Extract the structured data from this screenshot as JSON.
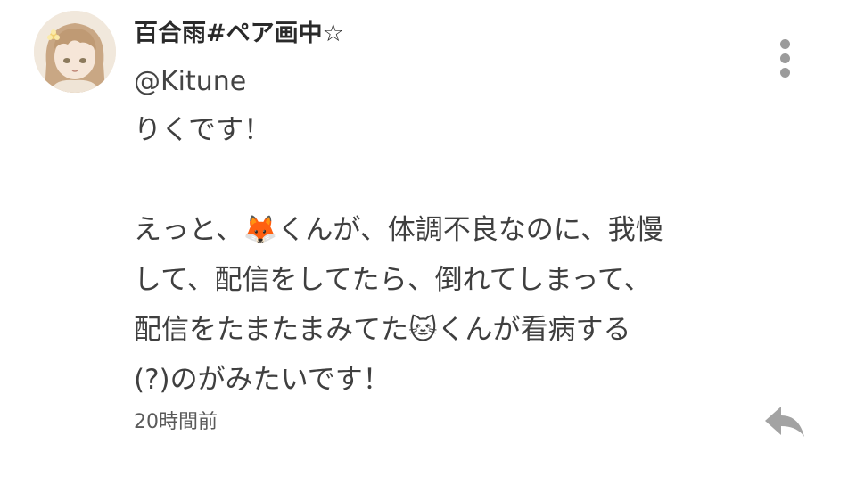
{
  "comment": {
    "display_name": "百合雨#ペア画中☆",
    "handle": "@Kitune",
    "body": "りくです！\n\nえっと、🦊くんが、体調不良なのに、我慢\nして、配信をしてたら、倒れてしまって、\n配信をたまたまみてた🐱くんが看病する\n(?)のがみたいです！",
    "timestamp": "20時間前"
  },
  "icons": {
    "more": "more-vertical-icon",
    "reply": "reply-icon"
  },
  "colors": {
    "icon_gray": "#9b9b9b",
    "text": "#3f3f3f",
    "background": "#ffffff"
  }
}
